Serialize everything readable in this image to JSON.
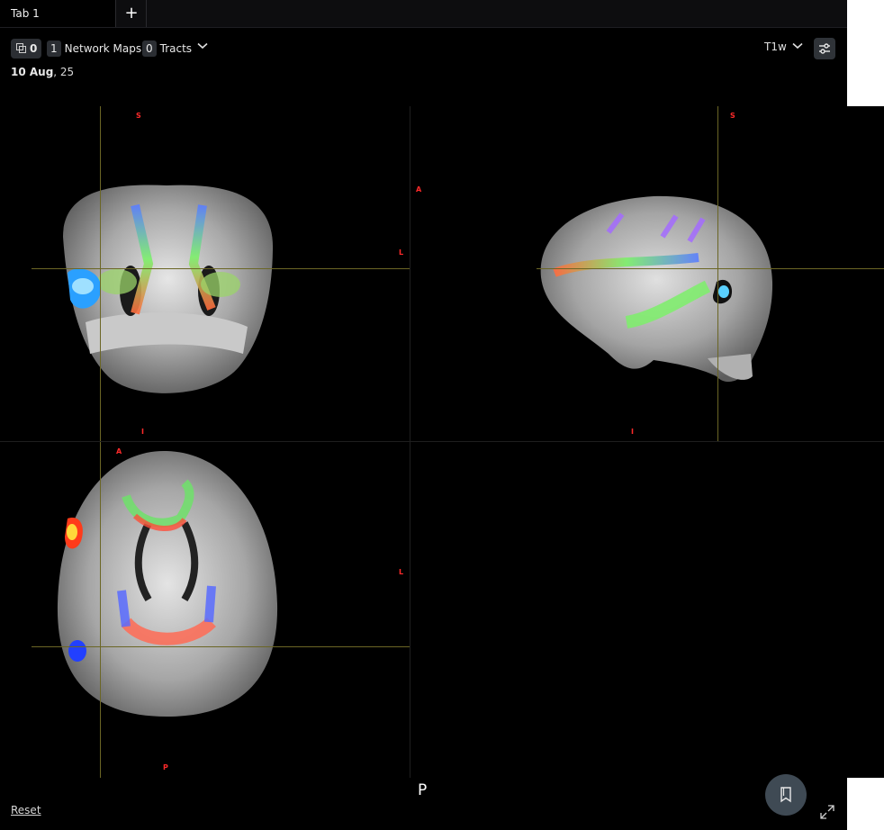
{
  "tabs": [
    {
      "label": "Tab 1"
    }
  ],
  "add_tab_label": "+",
  "toolbar": {
    "layers_count": "0",
    "network_maps_count": "1",
    "network_maps_label": "Network Maps",
    "tracts_count": "0",
    "tracts_label": "Tracts",
    "modality": "T1w"
  },
  "date": {
    "day_month": "10 Aug",
    "year": ", 25"
  },
  "views": {
    "coronal": {
      "top": "S",
      "bottom": "I",
      "right": "L"
    },
    "sagittal": {
      "top": "S",
      "bottom": "I",
      "left": "A"
    },
    "axial": {
      "top": "A",
      "bottom": "P",
      "right": "L"
    }
  },
  "footer": {
    "reset_label": "Reset",
    "orientation_label": "P"
  },
  "icons": {
    "layers": "layers-icon",
    "chevron": "chevron-down-icon",
    "settings": "sliders-icon",
    "bookmark": "bookmark-icon",
    "expand": "expand-icon"
  },
  "colors": {
    "background": "#000000",
    "label_red": "#ff2a2a",
    "crosshair": "#6b6625",
    "chip": "#2b2e33"
  }
}
